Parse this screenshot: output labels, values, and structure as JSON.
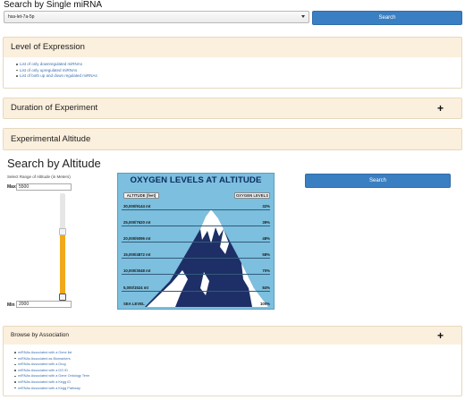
{
  "top_search": {
    "title": "Search by Single miRNA",
    "selected_mirna": "hsa-let-7a-5p",
    "button_label": "Search"
  },
  "level_panel": {
    "title": "Level of Expression",
    "links": [
      "List of only downregulated miRNAs",
      "List of only upregulated miRNAs",
      "List of both up and down regulated miRNAs"
    ]
  },
  "duration_panel": {
    "title": "Duration of Experiment",
    "toggle": "+"
  },
  "altitude_panel": {
    "title": "Experimental Altitude"
  },
  "altitude_search": {
    "title": "Search by Altitude",
    "range_label": "Select Range of Altitude (in Meters)",
    "max_label": "Max",
    "max_value": "5500",
    "min_label": "Min",
    "min_value": "2000",
    "slider_max_fraction": 0.6,
    "slider_min_fraction": 0.0,
    "button_label": "Search"
  },
  "oxygen_chart": {
    "title": "OXYGEN LEVELS AT ALTITUDE",
    "col_altitude": "ALTITUDE (feet)",
    "col_oxygen": "OXYGEN LEVELS",
    "rows": [
      {
        "feet": "30,000",
        "meters": "9144 mt",
        "pct": "32%"
      },
      {
        "feet": "25,000",
        "meters": "7620 mt",
        "pct": "39%"
      },
      {
        "feet": "20,000",
        "meters": "6096 mt",
        "pct": "48%"
      },
      {
        "feet": "15,000",
        "meters": "4872 mt",
        "pct": "58%"
      },
      {
        "feet": "10,000",
        "meters": "3048 mt",
        "pct": "70%"
      },
      {
        "feet": "5,000",
        "meters": "1524 mt",
        "pct": "84%"
      }
    ],
    "sea_level_label": "SEA LEVEL",
    "sea_level_pct": "100%",
    "colors": {
      "sky": "#7cbfde",
      "mountain": "#1d2f66",
      "snow": "#ffffff",
      "title": "#0d2e63"
    }
  },
  "browse_panel": {
    "title": "Browse by Association",
    "toggle": "+",
    "links": [
      "miRNAs Associated with a Gene list",
      "miRNAs Associated as Biomarkers",
      "miRNAs Associated with a Drug",
      "miRNAs Associated with a DO ID",
      "miRNAs Associated with a Gene Ontology Term",
      "miRNAs Associated with a Kegg ID",
      "miRNAs Associated with a Kegg Pathway"
    ]
  }
}
